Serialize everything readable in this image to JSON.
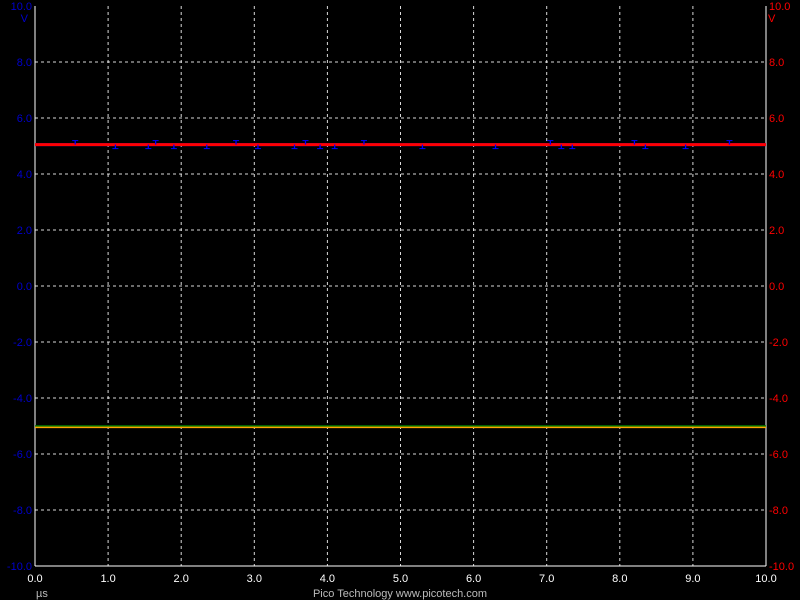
{
  "colors": {
    "background": "#000000",
    "grid": "#ffffff",
    "axis_left": "#0000cc",
    "axis_right": "#ff0000",
    "x_axis": "#ffffff",
    "footer": "#bbbbbb",
    "trace_a": "#ff0000",
    "trace_b": "#0000ff",
    "trace_c": "#ffa500",
    "trace_d": "#008000"
  },
  "footer": {
    "brand": "Pico Technology   www.picotech.com"
  },
  "chart_data": {
    "type": "line",
    "title": "",
    "xlabel": "µs",
    "ylabel_left": "V",
    "ylabel_right": "V",
    "xlim": [
      0,
      10
    ],
    "ylim": [
      -10,
      10
    ],
    "grid": true,
    "x_ticks": [
      "0.0",
      "1.0",
      "2.0",
      "3.0",
      "4.0",
      "5.0",
      "6.0",
      "7.0",
      "8.0",
      "9.0",
      "10.0"
    ],
    "y_ticks_left": [
      "10.0",
      "8.0",
      "6.0",
      "4.0",
      "2.0",
      "0.0",
      "-2.0",
      "-4.0",
      "-6.0",
      "-8.0",
      "-10.0"
    ],
    "y_ticks_right": [
      "10.0",
      "8.0",
      "6.0",
      "4.0",
      "2.0",
      "0.0",
      "-2.0",
      "-4.0",
      "-6.0",
      "-8.0",
      "-10.0"
    ],
    "series": [
      {
        "color": "#0000ff",
        "x": [
          0,
          10
        ],
        "y": [
          5.05,
          5.05
        ]
      },
      {
        "color": "#ff0000",
        "x": [
          0,
          10
        ],
        "y": [
          5.05,
          5.05
        ]
      },
      {
        "color": "#008000",
        "x": [
          0,
          10
        ],
        "y": [
          -5.0,
          -5.0
        ]
      },
      {
        "color": "#ffa500",
        "x": [
          0,
          10
        ],
        "y": [
          -5.05,
          -5.05
        ]
      }
    ]
  }
}
